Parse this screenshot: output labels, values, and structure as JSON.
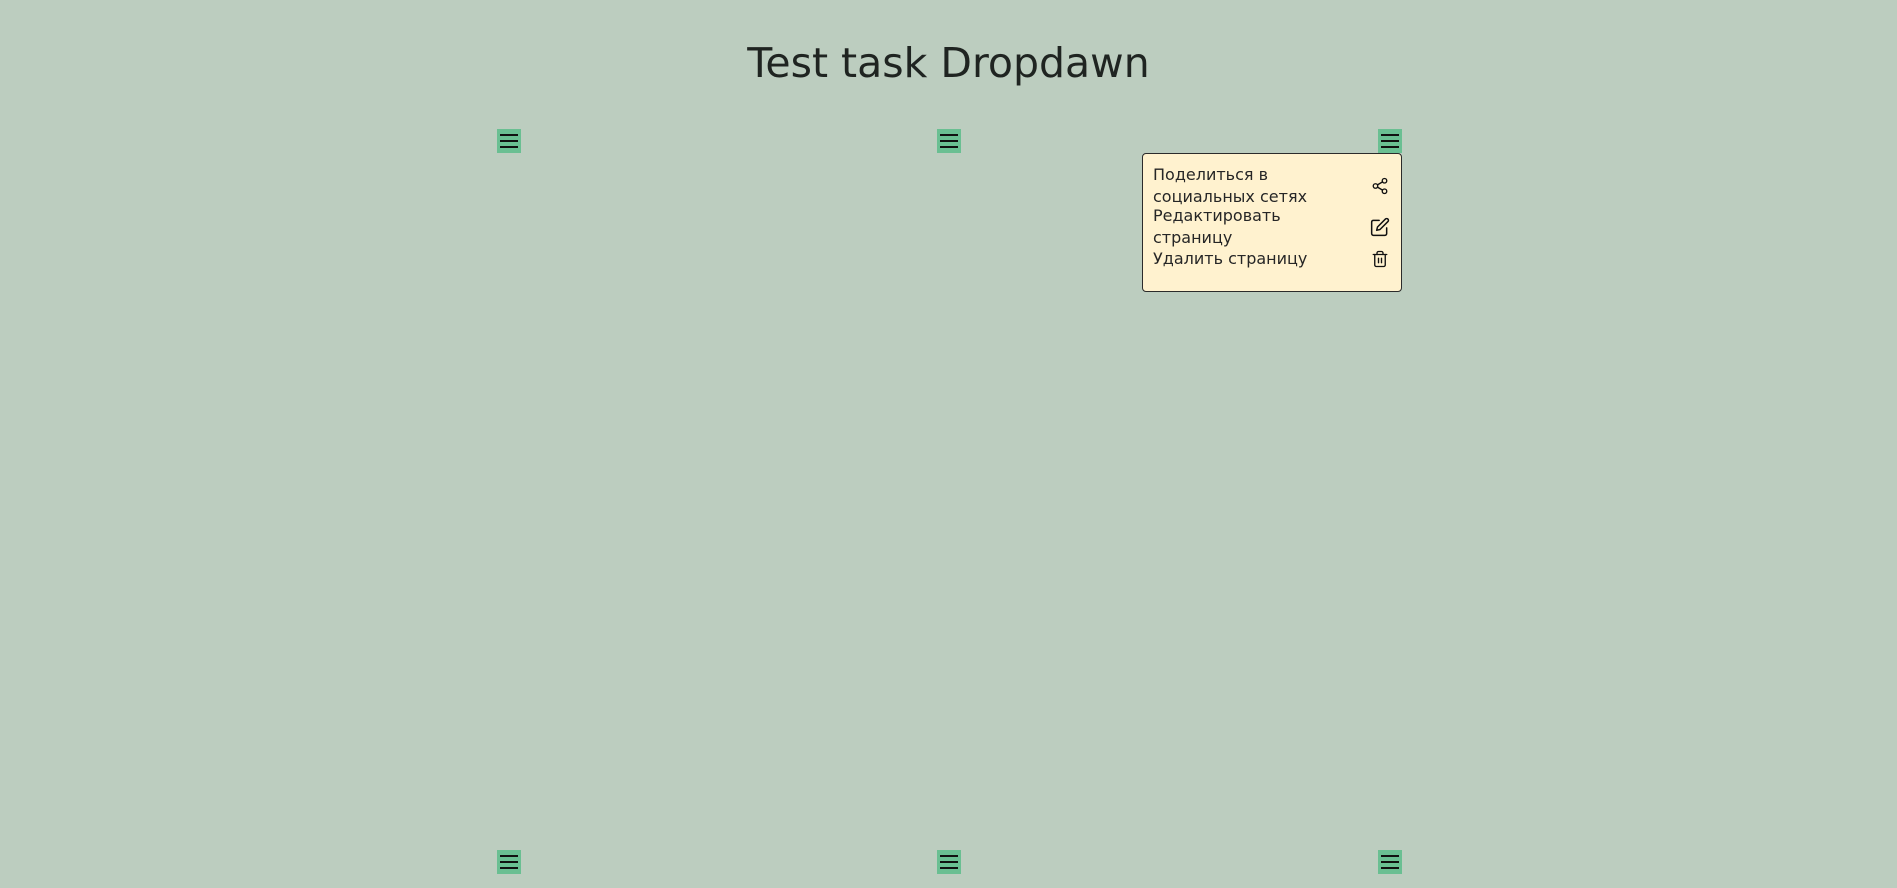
{
  "page": {
    "title": "Test task Dropdawn"
  },
  "colors": {
    "background": "#bccdbf",
    "menu_button": "#6abf92",
    "dropdown_bg": "#fff2cf"
  },
  "menu_buttons": {
    "icon": "hamburger-icon"
  },
  "dropdown": {
    "items": [
      {
        "label": "Поделиться в социальных сетях",
        "icon": "share-icon"
      },
      {
        "label": "Редактировать страницу",
        "icon": "edit-icon"
      },
      {
        "label": "Удалить страницу",
        "icon": "trash-icon"
      }
    ]
  }
}
